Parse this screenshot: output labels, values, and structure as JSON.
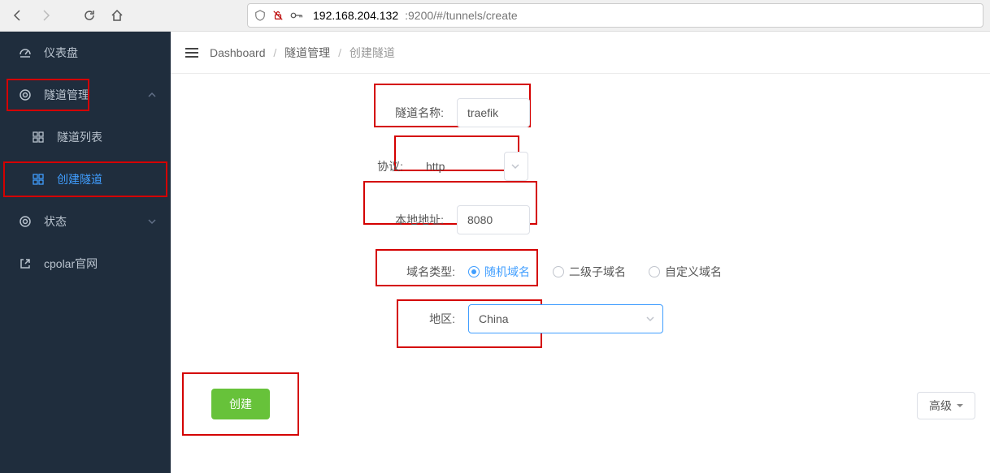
{
  "browser": {
    "url_ip": "192.168.204.132",
    "url_rest": ":9200/#/tunnels/create"
  },
  "sidebar": {
    "items": [
      {
        "icon": "dashboard",
        "label": "仪表盘"
      },
      {
        "icon": "tunnel",
        "label": "隧道管理",
        "expanded": true
      },
      {
        "icon": "list",
        "label": "隧道列表",
        "sub": true
      },
      {
        "icon": "create",
        "label": "创建隧道",
        "sub": true,
        "active": true
      },
      {
        "icon": "status",
        "label": "状态",
        "expandable": true
      },
      {
        "icon": "ext",
        "label": "cpolar官网"
      }
    ]
  },
  "breadcrumb": {
    "root": "Dashboard",
    "mid": "隧道管理",
    "cur": "创建隧道"
  },
  "form": {
    "name_label": "隧道名称:",
    "name_value": "traefik",
    "protocol_label": "协议:",
    "protocol_value": "http",
    "addr_label": "本地地址:",
    "addr_value": "8080",
    "domain_label": "域名类型:",
    "domain_options": [
      "随机域名",
      "二级子域名",
      "自定义域名"
    ],
    "domain_selected_index": 0,
    "region_label": "地区:",
    "region_value": "China",
    "advanced_label": "高级",
    "submit_label": "创建"
  }
}
